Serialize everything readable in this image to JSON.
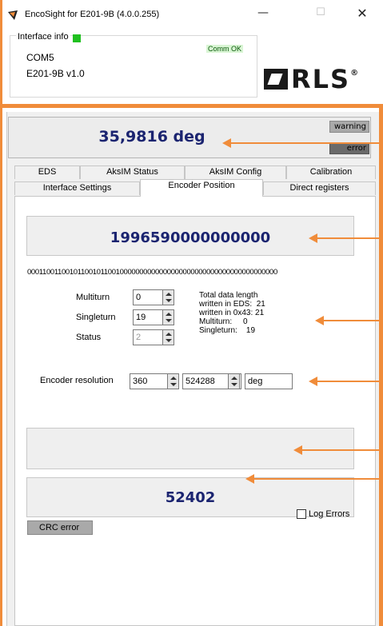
{
  "window": {
    "title": "EncoSight for E201-9B (4.0.0.255)",
    "min_glyph": "—",
    "max_glyph": "☐",
    "close_glyph": "✕"
  },
  "interface_info": {
    "legend": "Interface info",
    "status_text": "Comm OK",
    "com_port": "COM5",
    "device": "E201-9B v1.0",
    "led_color": "#20c020"
  },
  "logo": {
    "text": "RLS",
    "reg": "®"
  },
  "position_display": {
    "value": "35,9816 deg",
    "warning_label": "warning",
    "error_label": "error"
  },
  "tabs": {
    "row1": [
      "EDS",
      "AksIM Status",
      "AksIM Config",
      "Calibration"
    ],
    "row2": [
      "Interface Settings",
      "Encoder Position",
      "Direct registers"
    ],
    "active": "Encoder Position"
  },
  "encoder_position": {
    "raw_value": "1996590000000000",
    "bits": "0001100110010110010110010000000000000000000000000000000000000000",
    "multiturn_label": "Multiturn",
    "multiturn_value": "0",
    "singleturn_label": "Singleturn",
    "singleturn_value": "19",
    "status_label": "Status",
    "status_value": "2",
    "info_text": "Total data length\nwritten in EDS:  21\nwritten in 0x43: 21\nMultiturn:     0\nSingleturn:    19",
    "resolution_label": "Encoder resolution",
    "resolution_value1": "360",
    "resolution_value2": "524288",
    "resolution_unit": "deg",
    "numeric_value": "52402",
    "log_errors_label": "Log Errors",
    "crc_error_label": "CRC error"
  },
  "colors": {
    "accent": "#f08c3a",
    "value_text": "#1b2470"
  }
}
